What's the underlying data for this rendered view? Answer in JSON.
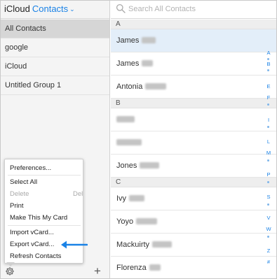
{
  "sidebar": {
    "brand_icloud": "iCloud",
    "brand_contacts": "Contacts",
    "groups": [
      "All Contacts",
      "google",
      "iCloud",
      "Untitled Group 1"
    ]
  },
  "menu": {
    "preferences": "Preferences...",
    "select_all": "Select All",
    "delete": "Delete",
    "delete_shortcut": "Del",
    "print": "Print",
    "make_my_card": "Make This My Card",
    "import_vcard": "Import vCard...",
    "export_vcard": "Export vCard...",
    "refresh": "Refresh Contacts"
  },
  "search": {
    "placeholder": "Search All Contacts"
  },
  "sections": [
    {
      "letter": "A",
      "contacts": [
        "James",
        "James",
        "Antonia"
      ]
    },
    {
      "letter": "B",
      "contacts": [
        "",
        "",
        "Jones"
      ]
    },
    {
      "letter": "C",
      "contacts": [
        "Ivy",
        "Yoyo",
        "Mackuirty",
        "Florenza"
      ]
    }
  ],
  "index_letters": [
    "A",
    "B",
    "E",
    "F",
    "I",
    "L",
    "M",
    "P",
    "S",
    "V",
    "W",
    "Z",
    "#"
  ],
  "colors": {
    "accent": "#1a82e6",
    "selected_row": "#e3eef9",
    "sidebar_bg": "#f4f4f4"
  }
}
